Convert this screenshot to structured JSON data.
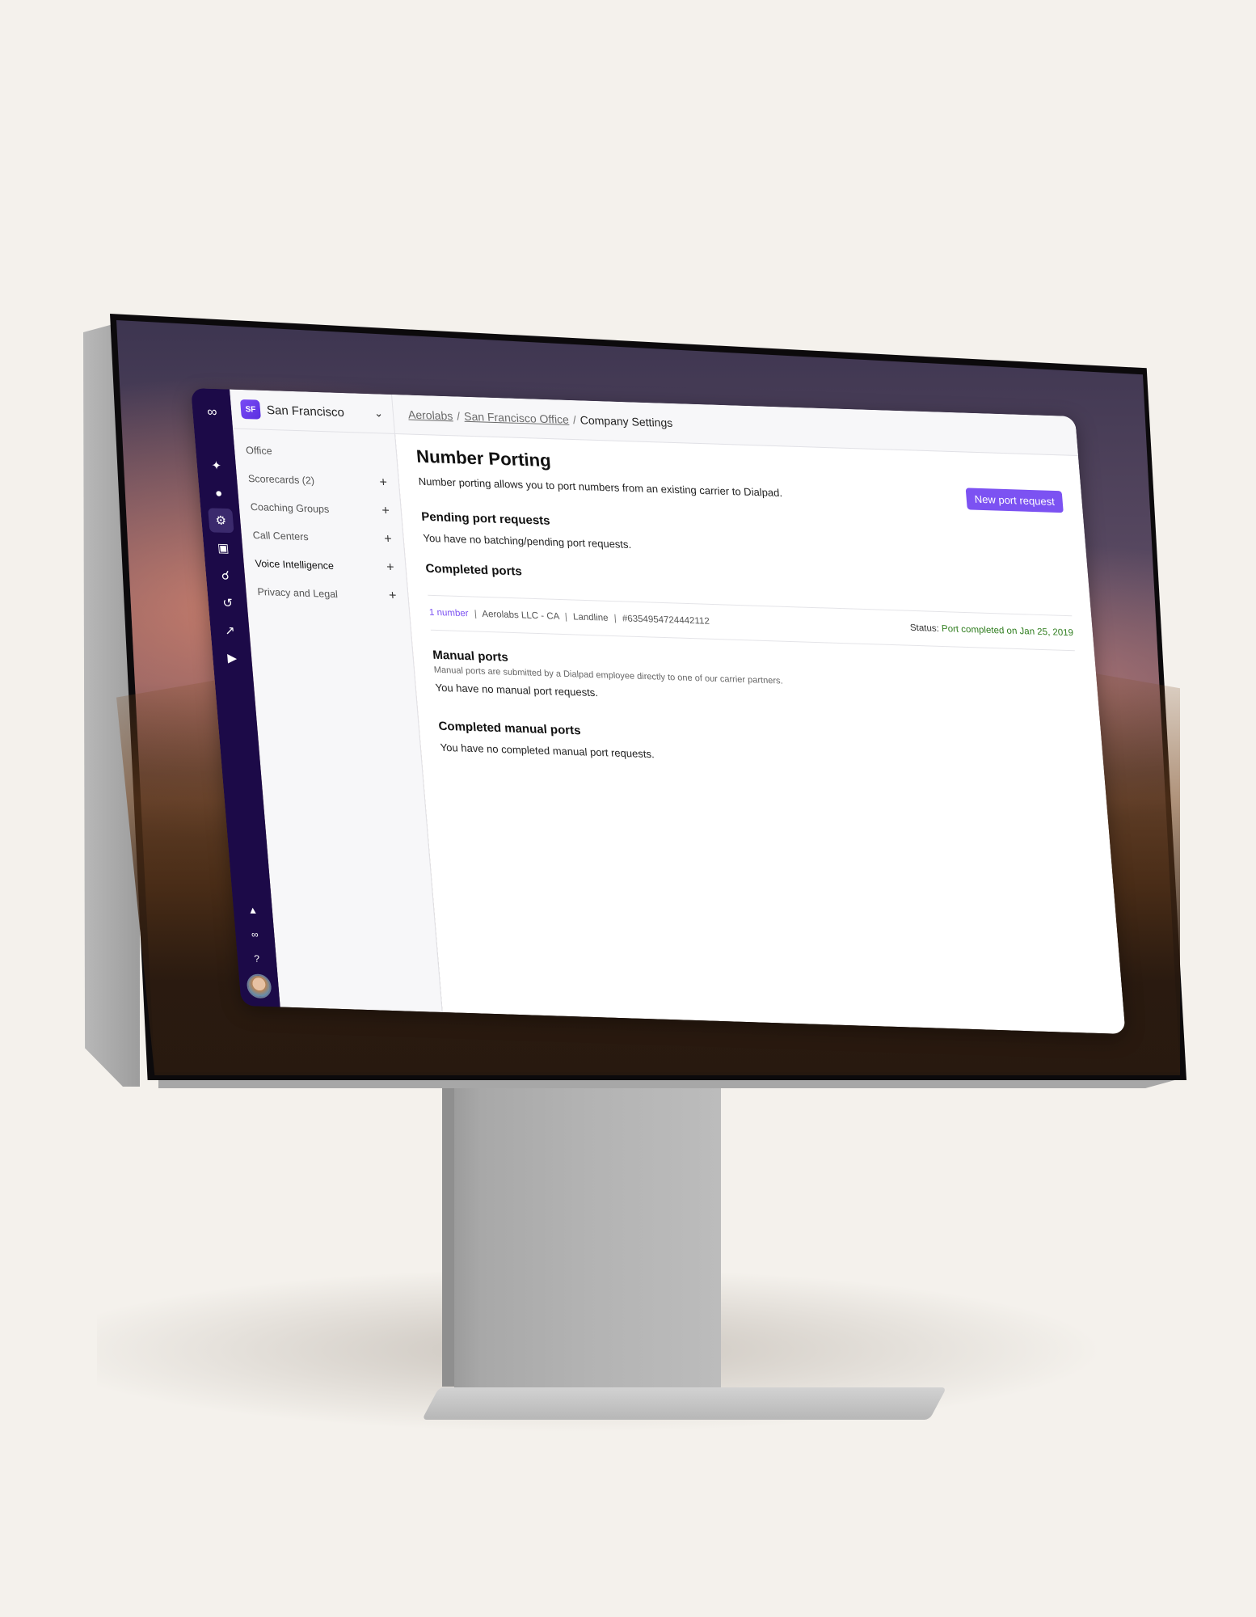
{
  "app": {
    "rail": {
      "logo_icon": "dialpad-logo-icon",
      "items": [
        {
          "name": "ai-sparkle-icon",
          "glyph": "✦"
        },
        {
          "name": "user-icon",
          "glyph": "👤"
        },
        {
          "name": "gear-icon",
          "glyph": "⚙",
          "active": true
        },
        {
          "name": "team-icon",
          "glyph": "👥"
        },
        {
          "name": "headset-icon",
          "glyph": "🎧"
        },
        {
          "name": "history-icon",
          "glyph": "↺"
        },
        {
          "name": "analytics-icon",
          "glyph": "↗"
        },
        {
          "name": "video-settings-icon",
          "glyph": "📹"
        }
      ],
      "bottom": [
        {
          "name": "bell-icon",
          "glyph": "🔔"
        },
        {
          "name": "dialpad-icon",
          "glyph": "∞"
        },
        {
          "name": "help-icon",
          "glyph": "?"
        }
      ]
    },
    "sidebar": {
      "badge": "SF",
      "office_name": "San Francisco",
      "items": [
        {
          "label": "Office",
          "has_add": false
        },
        {
          "label": "Scorecards (2)",
          "has_add": true
        },
        {
          "label": "Coaching Groups",
          "has_add": true
        },
        {
          "label": "Call Centers",
          "has_add": true
        },
        {
          "label": "Voice Intelligence",
          "has_add": true,
          "active": true
        },
        {
          "label": "Privacy and Legal",
          "has_add": true
        }
      ]
    },
    "breadcrumb": {
      "items": [
        "Aerolabs",
        "San Francisco Office"
      ],
      "current": "Company Settings",
      "separator": "/"
    },
    "page": {
      "title": "Number Porting",
      "description": "Number porting allows you to port numbers from an existing carrier to Dialpad.",
      "new_button": "New port request",
      "pending": {
        "heading": "Pending port requests",
        "empty": "You have no batching/pending port requests."
      },
      "completed": {
        "heading": "Completed ports",
        "rows": [
          {
            "count": "1 number",
            "company": "Aerolabs LLC - CA",
            "type": "Landline",
            "id": "#6354954724442112",
            "status_label": "Status:",
            "status": "Port completed on Jan 25, 2019"
          }
        ]
      },
      "manual": {
        "heading": "Manual ports",
        "subtext": "Manual ports are submitted by a Dialpad employee directly to one of our carrier partners.",
        "empty": "You have no manual port requests."
      },
      "completed_manual": {
        "heading": "Completed manual ports",
        "empty": "You have no completed manual port requests."
      }
    },
    "colors": {
      "accent": "#7c52f2",
      "rail": "#1c0a48",
      "status_success": "#2f7d1e"
    }
  }
}
